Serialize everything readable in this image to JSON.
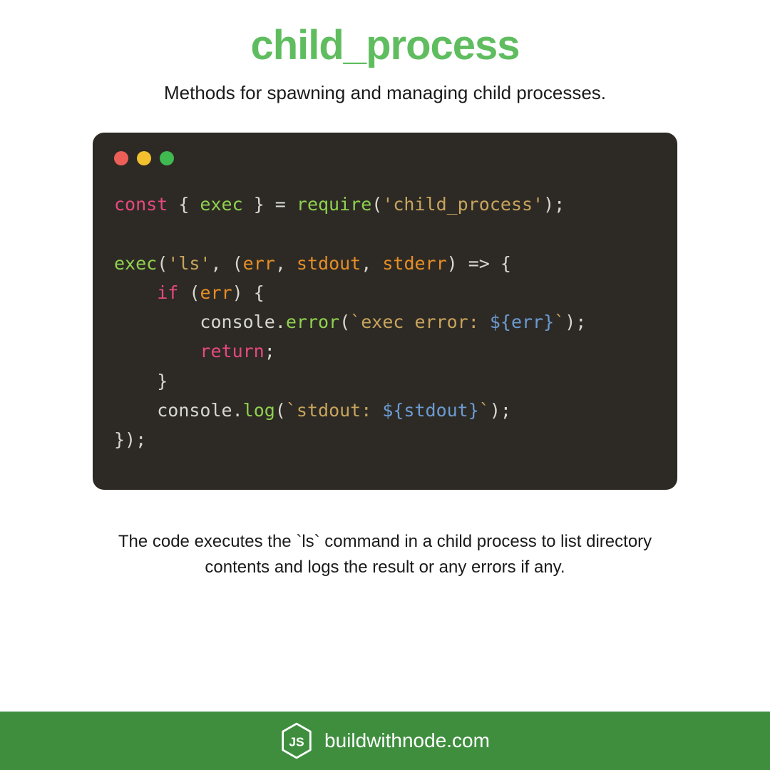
{
  "title": "child_process",
  "subtitle": "Methods for spawning and managing child processes.",
  "code": {
    "line1": {
      "kw_const": "const",
      "brace_l": " { ",
      "fn_exec": "exec",
      "brace_r": " } = ",
      "fn_require": "require",
      "paren_l": "(",
      "str_module": "'child_process'",
      "paren_r": ");"
    },
    "line3": {
      "fn_exec": "exec",
      "paren_l": "(",
      "str_ls": "'ls'",
      "comma": ", (",
      "p_err": "err",
      "c1": ", ",
      "p_stdout": "stdout",
      "c2": ", ",
      "p_stderr": "stderr",
      "arrow": ") => {"
    },
    "line4": {
      "indent": "    ",
      "kw_if": "if",
      "paren": " (",
      "p_err": "err",
      "close": ") {"
    },
    "line5": {
      "indent": "        ",
      "obj": "console.",
      "fn_error": "error",
      "paren_l": "(",
      "bt_l": "`exec error: ",
      "tmpl": "${err}",
      "bt_r": "`",
      "paren_r": ");"
    },
    "line6": {
      "indent": "        ",
      "kw_return": "return",
      "semi": ";"
    },
    "line7": {
      "indent": "    }"
    },
    "line8": {
      "indent": "    ",
      "obj": "console.",
      "fn_log": "log",
      "paren_l": "(",
      "bt_l": "`stdout: ",
      "tmpl": "${stdout}",
      "bt_r": "`",
      "paren_r": ");"
    },
    "line9": "});"
  },
  "description": "The code executes the `ls` command in a child process to list directory contents and logs the result or any errors if any.",
  "footer": {
    "site": "buildwithnode.com"
  },
  "colors": {
    "accent_green": "#5fbd5f",
    "code_bg": "#2d2a25",
    "footer_bg": "#3e8e3e"
  }
}
